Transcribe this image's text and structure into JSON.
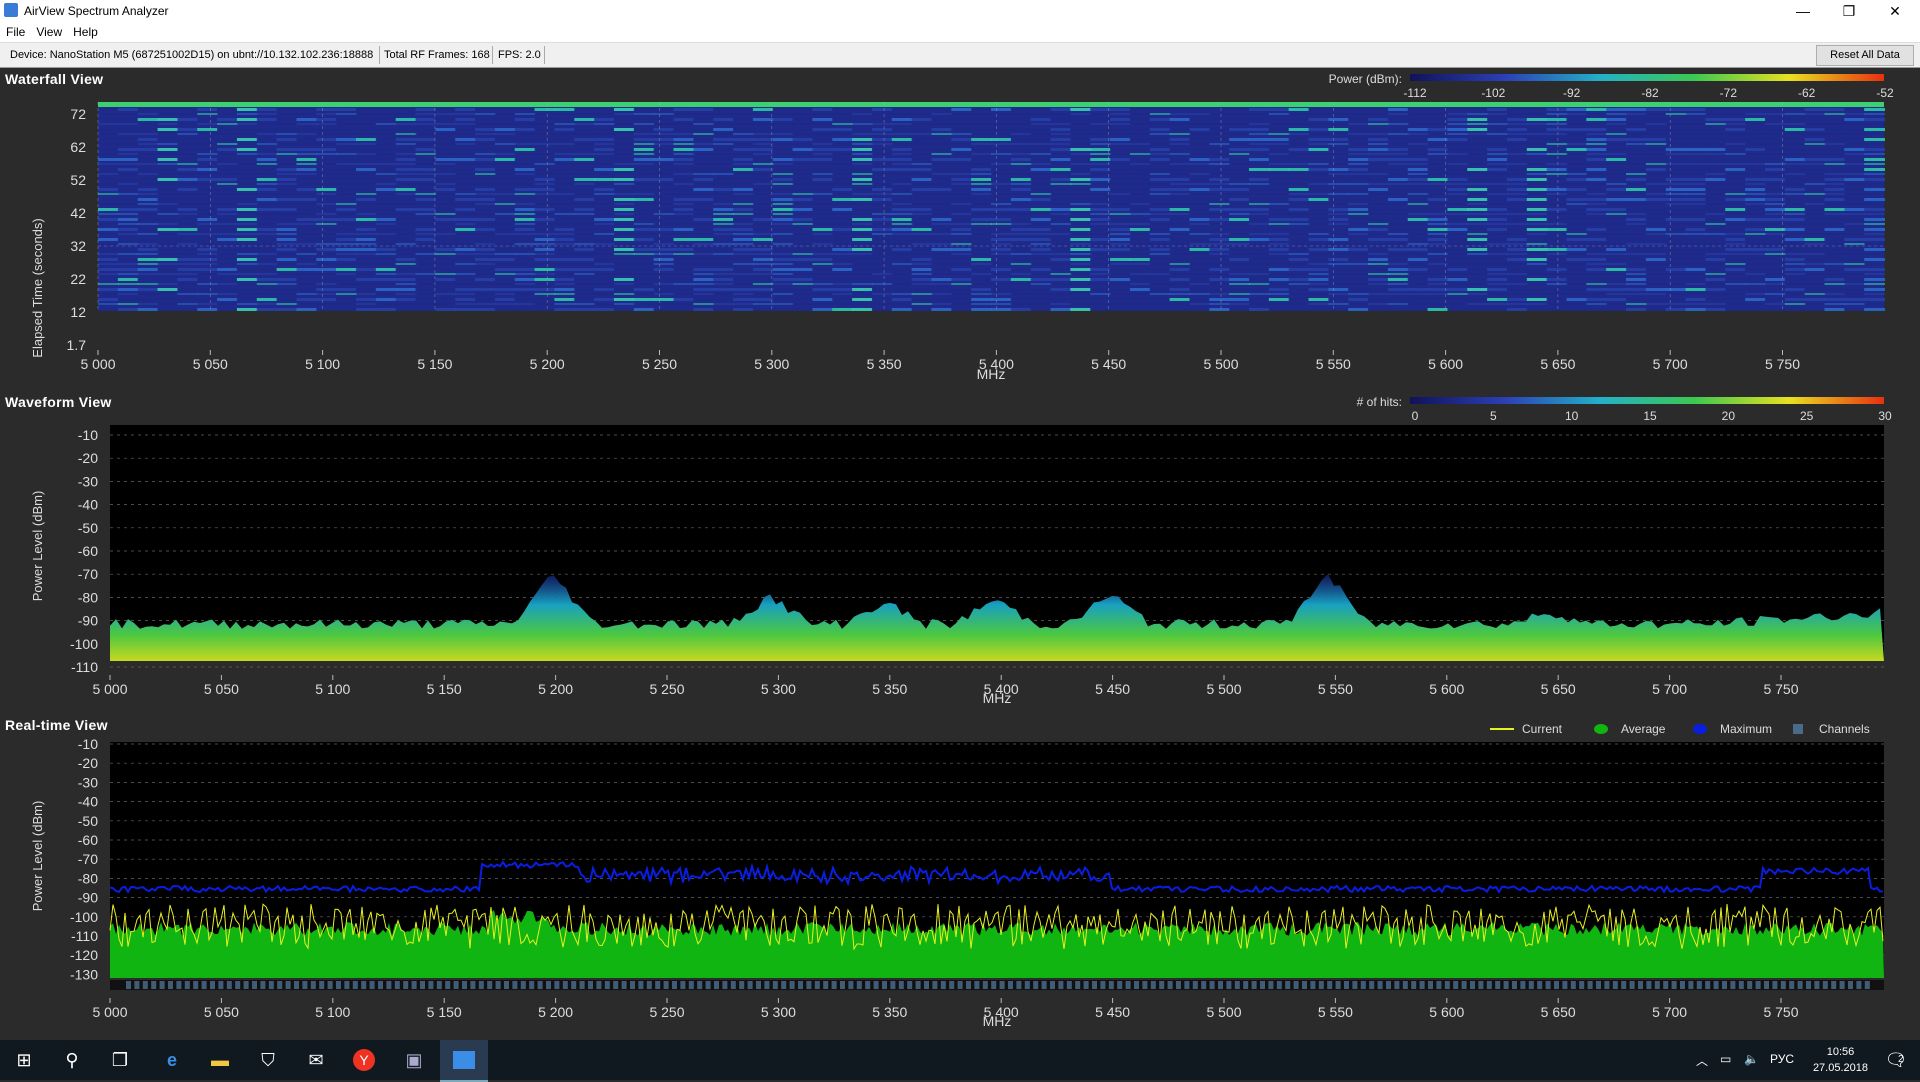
{
  "window": {
    "title": "AirView Spectrum Analyzer",
    "minimize_glyph": "—",
    "restore_glyph": "❐",
    "close_glyph": "✕"
  },
  "menu": [
    "File",
    "View",
    "Help"
  ],
  "status": {
    "device": "Device: NanoStation M5 (687251002D15) on ubnt://10.132.102.236:18888",
    "frames": "Total RF Frames: 168",
    "fps": "FPS: 2.0",
    "reset_label": "Reset All Data"
  },
  "colors": {
    "background": "#2b2b2b",
    "plot_bg": "#000000",
    "waterfall_base": "#1f2a8a",
    "maximum": "#0a1ee0",
    "current": "#e8f020",
    "average": "#11b511",
    "channels": "#4a6a8a"
  },
  "waterfall": {
    "title": "Waterfall View",
    "legend_label": "Power (dBm):",
    "legend_ticks": [
      "-112",
      "-102",
      "-92",
      "-82",
      "-72",
      "-62",
      "-52"
    ],
    "y_label": "Elapsed Time (seconds)",
    "y_ticks": [
      "72",
      "62",
      "52",
      "42",
      "32",
      "22",
      "12",
      "1.7"
    ],
    "x_label": "MHz"
  },
  "waveform": {
    "title": "Waveform View",
    "legend_label": "# of hits:",
    "legend_ticks": [
      "0",
      "5",
      "10",
      "15",
      "20",
      "25",
      "30"
    ],
    "y_label": "Power Level (dBm)",
    "y_ticks": [
      "-10",
      "-20",
      "-30",
      "-40",
      "-50",
      "-60",
      "-70",
      "-80",
      "-90",
      "-100",
      "-110"
    ],
    "x_label": "MHz"
  },
  "realtime": {
    "title": "Real-time View",
    "legend": [
      {
        "name": "Current",
        "color": "#e8f020"
      },
      {
        "name": "Average",
        "color": "#11b511"
      },
      {
        "name": "Maximum",
        "color": "#0a1ee0"
      },
      {
        "name": "Channels",
        "color": "#4a6a8a"
      }
    ],
    "y_label": "Power Level (dBm)",
    "y_ticks": [
      "-10",
      "-20",
      "-30",
      "-40",
      "-50",
      "-60",
      "-70",
      "-80",
      "-90",
      "-100",
      "-110",
      "-120",
      "-130"
    ],
    "x_label": "MHz"
  },
  "freq_ticks": [
    "5 000",
    "5 050",
    "5 100",
    "5 150",
    "5 200",
    "5 250",
    "5 300",
    "5 350",
    "5 400",
    "5 450",
    "5 500",
    "5 550",
    "5 600",
    "5 650",
    "5 700",
    "5 750"
  ],
  "taskbar": {
    "icons": [
      "windows-start-icon",
      "search-icon",
      "task-view-icon",
      "edge-icon",
      "file-explorer-icon",
      "store-icon",
      "mail-icon",
      "yandex-browser-icon",
      "app-icon",
      "airview-icon"
    ],
    "lang": "РУС",
    "time": "10:56",
    "date": "27.05.2018",
    "notif_count": "2"
  }
}
